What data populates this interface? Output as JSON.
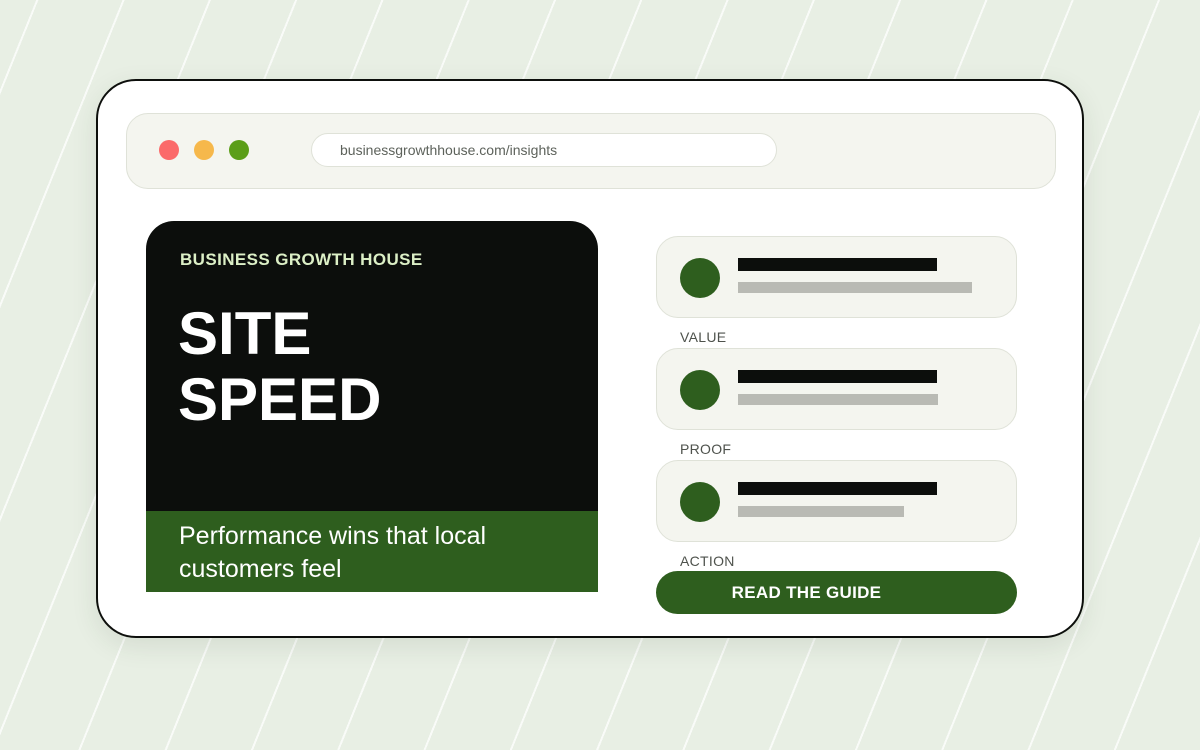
{
  "browser": {
    "url": "businessgrowthhouse.com/insights",
    "window_controls": [
      "close",
      "minimize",
      "maximize"
    ]
  },
  "hero": {
    "brand": "BUSINESS GROWTH HOUSE",
    "title_lines": [
      "SITE",
      "SPEED"
    ],
    "subtitle": "Performance wins that local customers feel"
  },
  "steps": [
    {
      "label": "VALUE",
      "icon": "green-circle-icon"
    },
    {
      "label": "PROOF",
      "icon": "green-circle-icon"
    },
    {
      "label": "ACTION",
      "icon": "green-circle-icon"
    }
  ],
  "cta": {
    "label": "READ THE GUIDE"
  },
  "colors": {
    "accent_green": "#2e5e1e",
    "dark": "#0c0e0c",
    "brand_text": "#dcefc6",
    "background": "#e8efe4",
    "dot_red": "#fb6a6a",
    "dot_yellow": "#f6b84b",
    "dot_green": "#5b9e18"
  }
}
